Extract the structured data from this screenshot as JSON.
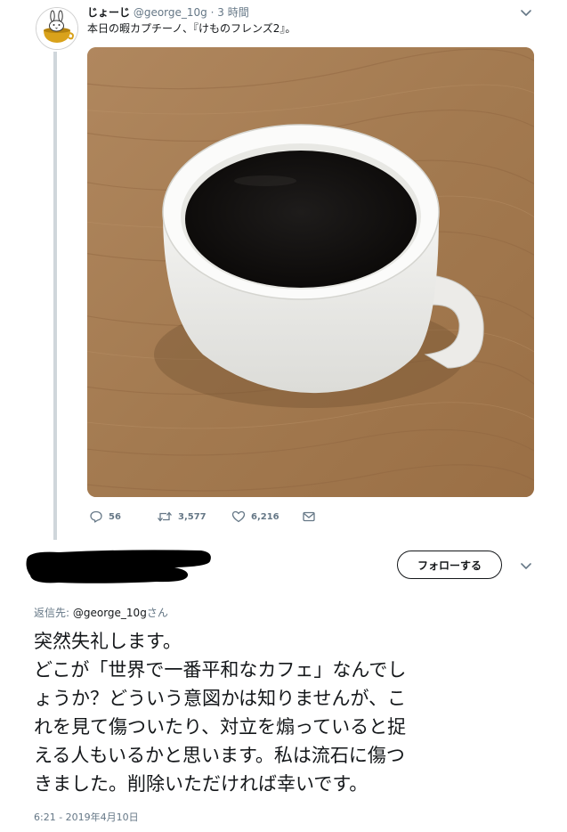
{
  "original_tweet": {
    "display_name": "じょーじ",
    "handle": "@george_10g",
    "separator": "·",
    "time": "3 時間",
    "text": "本日の暇カプチーノ、『けものフレンズ2』。",
    "menu_icon": "chevron-down-icon",
    "actions": {
      "reply_count": "56",
      "retweet_count": "3,577",
      "like_count": "6,216"
    },
    "colors": {
      "thread_line": "#cfd6db",
      "meta_text": "#657786"
    }
  },
  "reply": {
    "follow_button_label": "フォローする",
    "reply_to_prefix": "返信先: ",
    "reply_to_mention": "@george_10g",
    "reply_to_suffix": "さん",
    "body_lines": [
      "突然失礼します。",
      "どこが「世界で一番平和なカフェ」なんでし",
      "ょうか？どういう意図かは知りませんが、こ",
      "れを見て傷ついたり、対立を煽っていると捉",
      "える人もいるかと思います。私は流石に傷つ",
      "きました。削除いただければ幸いです。"
    ],
    "timestamp": "6:21 - 2019年4月10日"
  }
}
